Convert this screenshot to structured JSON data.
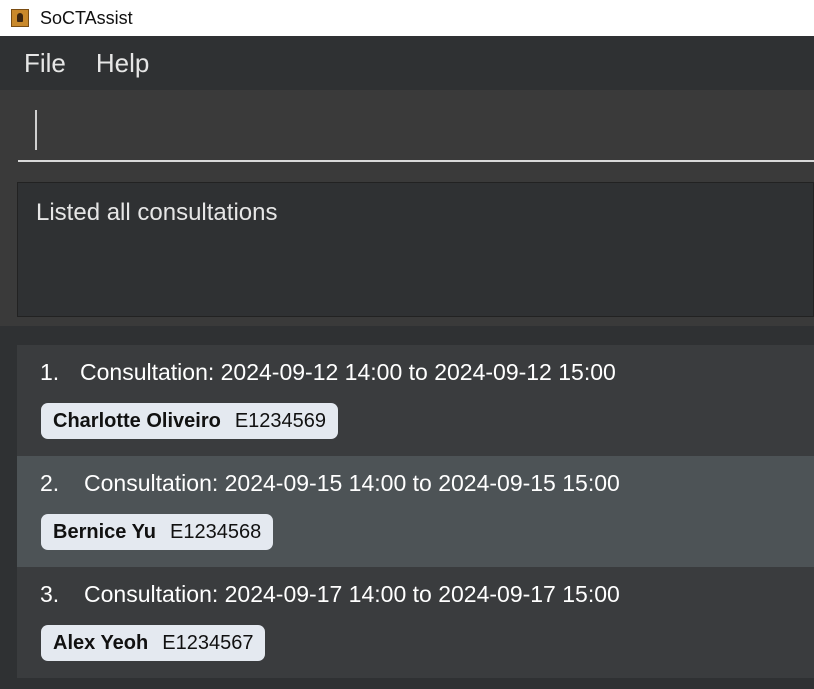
{
  "window": {
    "title": "SoCTAssist"
  },
  "menu": {
    "items": [
      "File",
      "Help"
    ]
  },
  "command_box": {
    "value": ""
  },
  "result_display": {
    "text": "Listed all consultations"
  },
  "consultations": [
    {
      "index": "1.",
      "text": "Consultation: 2024-09-12 14:00 to 2024-09-12 15:00",
      "student_name": "Charlotte Oliveiro",
      "student_id": "E1234569",
      "selected": false
    },
    {
      "index": "2.",
      "text": "Consultation: 2024-09-15 14:00 to 2024-09-15 15:00",
      "student_name": "Bernice Yu",
      "student_id": "E1234568",
      "selected": true
    },
    {
      "index": "3.",
      "text": "Consultation: 2024-09-17 14:00 to 2024-09-17 15:00",
      "student_name": "Alex Yeoh",
      "student_id": "E1234567",
      "selected": false
    }
  ],
  "colors": {
    "selected_row": "#4d5356",
    "row_a": "#3a3c3e",
    "row_b": "#313335",
    "tag_bg": "#e4e9f0"
  }
}
